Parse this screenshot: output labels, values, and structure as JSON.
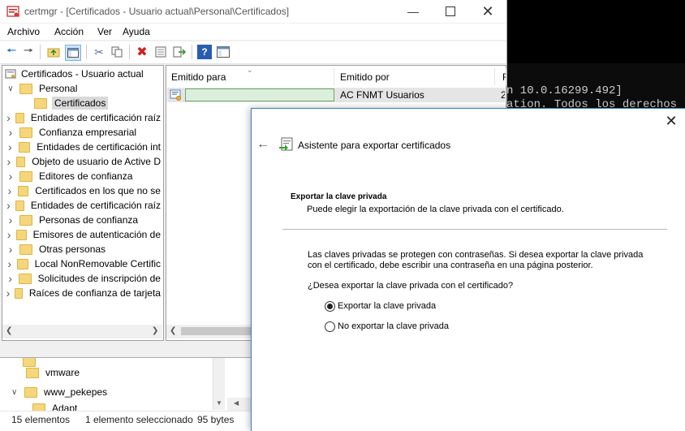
{
  "console": {
    "line1": "n 10.0.16299.492]",
    "line2": "ation. Todos los derechos re"
  },
  "explorer": {
    "items": [
      {
        "label": "vmware",
        "expanded": false
      },
      {
        "label": "www_pekepes",
        "expanded": true
      },
      {
        "label": "Adapt"
      }
    ],
    "status": {
      "count": "15 elementos",
      "selection": "1 elemento seleccionado",
      "size": "95 bytes"
    }
  },
  "certmgr": {
    "title": "certmgr - [Certificados - Usuario actual\\Personal\\Certificados]",
    "menu": [
      "Archivo",
      "Acción",
      "Ver",
      "Ayuda"
    ],
    "toolbar_icons": [
      "back-arrow-icon",
      "forward-arrow-icon",
      "up-folder-icon",
      "show-hide-tree-icon",
      "cut-icon",
      "copy-icon",
      "delete-icon",
      "properties-icon",
      "export-list-icon",
      "help-icon",
      "console-icon"
    ],
    "tree": {
      "root": "Certificados - Usuario actual",
      "personal": "Personal",
      "selected": "Certificados",
      "items": [
        "Entidades de certificación raíz",
        "Confianza empresarial",
        "Entidades de certificación int",
        "Objeto de usuario de Active D",
        "Editores de confianza",
        "Certificados en los que no se",
        "Entidades de certificación raíz",
        "Personas de confianza",
        "Emisores de autenticación de",
        "Otras personas",
        "Local NonRemovable Certific",
        "Solicitudes de inscripción de",
        "Raíces de confianza de tarjeta"
      ]
    },
    "list": {
      "columns": [
        "Emitido para",
        "Emitido por",
        "F"
      ],
      "rows": [
        {
          "issued_to": "",
          "issued_by": "AC FNMT Usuarios",
          "expiry": "2"
        }
      ]
    }
  },
  "wizard": {
    "title": "Asistente para exportar certificados",
    "section_title": "Exportar la clave privada",
    "section_subtitle": "Puede elegir la exportación de la clave privada con el certificado.",
    "body_line1": "Las claves privadas se protegen con contraseñas. Si desea exportar la clave privada",
    "body_line2": "con el certificado, debe escribir una contraseña en una página posterior.",
    "question": "¿Desea exportar la clave privada con el certificado?",
    "options": [
      {
        "label": "Exportar la clave privada",
        "selected": true
      },
      {
        "label": "No exportar la clave privada",
        "selected": false
      }
    ]
  }
}
